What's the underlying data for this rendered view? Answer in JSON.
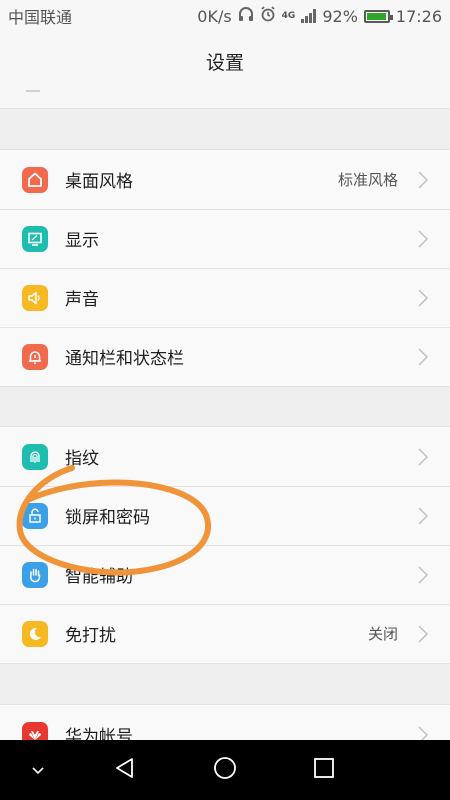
{
  "status_bar": {
    "carrier": "中国联通",
    "speed": "0K/s",
    "network": "4G",
    "battery": "92%",
    "time": "17:26"
  },
  "header": {
    "title": "设置"
  },
  "groups": [
    {
      "items": [
        {
          "label": "桌面风格",
          "value": "标准风格",
          "icon": "home-icon",
          "color": "#f16a4e"
        },
        {
          "label": "显示",
          "value": "",
          "icon": "display-icon",
          "color": "#1fbcb0"
        },
        {
          "label": "声音",
          "value": "",
          "icon": "speaker-icon",
          "color": "#f7b923"
        },
        {
          "label": "通知栏和状态栏",
          "value": "",
          "icon": "bell-icon",
          "color": "#f16a4e"
        }
      ]
    },
    {
      "items": [
        {
          "label": "指纹",
          "value": "",
          "icon": "fingerprint-icon",
          "color": "#1fbcb0"
        },
        {
          "label": "锁屏和密码",
          "value": "",
          "icon": "lock-icon",
          "color": "#3aa0e8"
        },
        {
          "label": "智能辅助",
          "value": "",
          "icon": "hand-icon",
          "color": "#3aa0e8"
        },
        {
          "label": "免打扰",
          "value": "关闭",
          "icon": "moon-icon",
          "color": "#f7b923"
        }
      ]
    },
    {
      "items": [
        {
          "label": "华为帐号",
          "value": "",
          "icon": "huawei-icon",
          "color": "#e8372f"
        }
      ]
    }
  ],
  "annotation": {
    "color": "#f0943a"
  }
}
